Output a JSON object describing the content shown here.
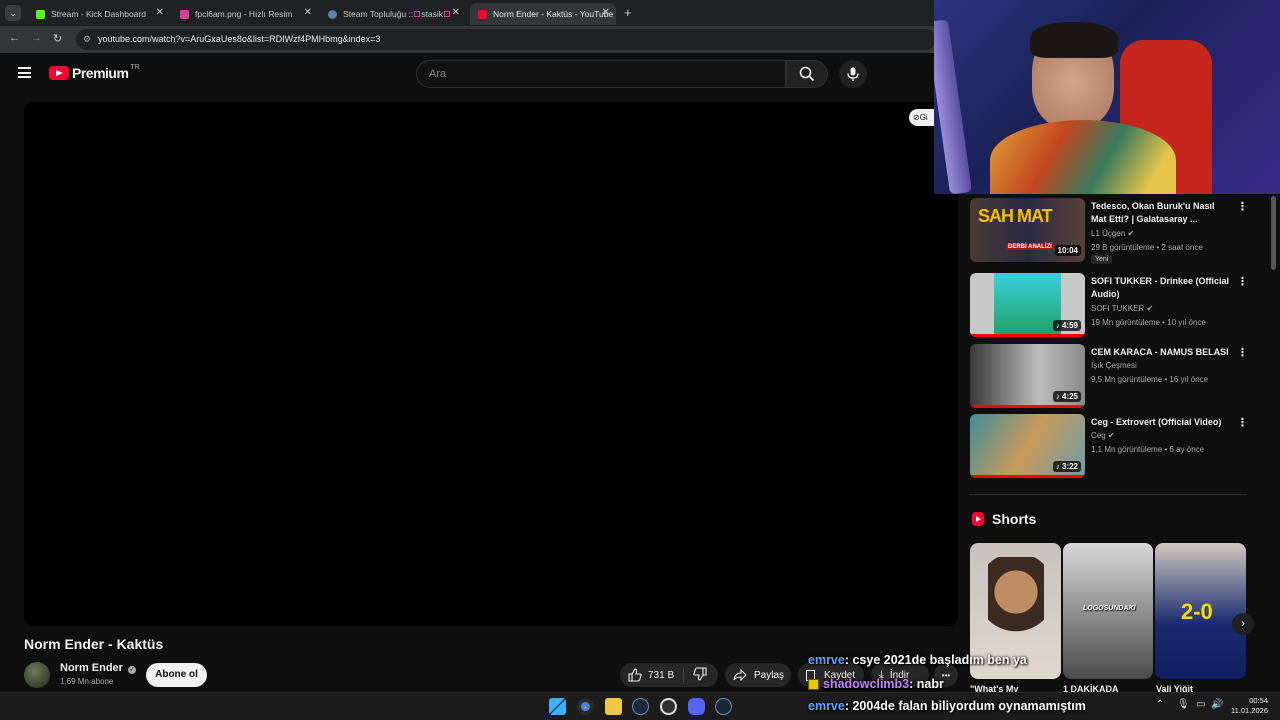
{
  "browser": {
    "tabs": [
      {
        "label": "Stream - Kick Dashboard",
        "color": "#53fc18"
      },
      {
        "label": "fpcl6am.png - Hızlı Resim",
        "color": "#e2399b"
      },
      {
        "label": "Steam Topluluğu :: ",
        "label2": "stasik",
        "color": "#5a7fb4"
      },
      {
        "label": "Norm Ender - Kaktüs - YouTube",
        "color": "#ff0033"
      }
    ],
    "url": "youtube.com/watch?v=AruGxaUes8o&list=RDIWzf4PMHbmg&index=3",
    "new_tab": "+",
    "close": "✕"
  },
  "youtube": {
    "logo_text": "Premium",
    "logo_region": "TR",
    "search_placeholder": "Ara",
    "overlay_badge": "Gi",
    "video": {
      "title": "Norm Ender - Kaktüs",
      "channel": "Norm Ender",
      "subscribers": "1,69 Mn abone",
      "subscribe_label": "Abone ol",
      "likes": "731 B",
      "share_label": "Paylaş",
      "save_label": "Kaydet",
      "download_label": "İndir",
      "more": "•••"
    },
    "sidebar": [
      {
        "title": "Tedesco, Okan Buruk'u Nasıl Mat Etti? | Galatasaray ...",
        "channel": "L1 Üçgen",
        "meta": "29 B görüntüleme • 2 saat önce",
        "badge": "Yeni",
        "duration": "10:04",
        "thumb_text": "SAH MAT",
        "thumb_sub": "DERBİ ANALİZİ"
      },
      {
        "title": "SOFI TUKKER - Drinkee (Official Audio)",
        "channel": "SOFI TUKKER",
        "meta": "19 Mn görüntüleme • 10 yıl önce",
        "duration": "♪ 4:59"
      },
      {
        "title": "CEM KARACA - NAMUS BELASI",
        "channel": "Işık Çeşmesi",
        "meta": "9,5 Mn görüntüleme • 16 yıl önce",
        "duration": "♪ 4:25"
      },
      {
        "title": "Ceg - Extrovert (Official Video)",
        "channel": "Ceg",
        "meta": "1,1 Mn görüntüleme • 6 ay önce",
        "duration": "♪ 3:22"
      }
    ],
    "shorts": {
      "heading": "Shorts",
      "items": [
        {
          "caption": "\"What's My",
          "thumb_text": ""
        },
        {
          "caption": "1 DAKİKADA",
          "thumb_text": "LOGOSUNDAKİ"
        },
        {
          "caption": "Vali Yiğit",
          "thumb_text": "2-0"
        }
      ]
    }
  },
  "chat": [
    {
      "user": "emrve",
      "text": ": csye 2021de başladım ben ya"
    },
    {
      "user": "shadowclimb3",
      "text": ": nabr"
    },
    {
      "user": "emrve",
      "text": ": 2004de falan biliyordum oynamamıştım"
    }
  ],
  "taskbar": {
    "time": "00:54",
    "date": "11.01.2026"
  },
  "colors": {
    "accent_red": "#ff0033",
    "chat_user_blue": "#5aa7ff",
    "chat_user_purple": "#c582ff"
  }
}
